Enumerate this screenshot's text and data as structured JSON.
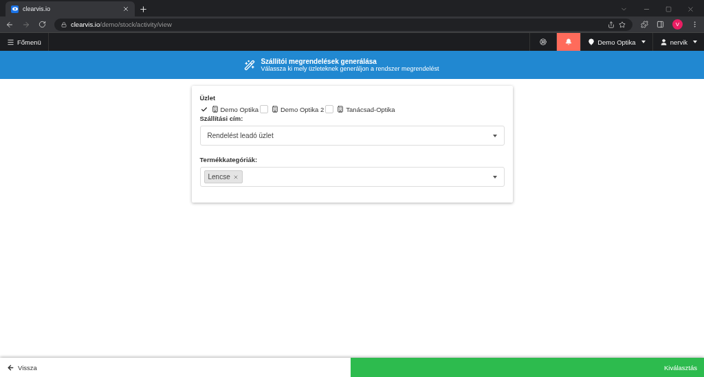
{
  "browser": {
    "tab_title": "clearvis.io",
    "url_host": "clearvis.io",
    "url_path": "/demo/stock/activity/view",
    "profile_initial": "V"
  },
  "navbar": {
    "menu_label": "Főmenü",
    "location": "Demo Optika",
    "user": "nervik",
    "alert_active": true
  },
  "banner": {
    "title": "Szállítói megrendelések generálása",
    "subtitle": "Válassza ki mely üzleteknek generáljon a rendszer megrendelést"
  },
  "form": {
    "store_label": "Üzlet",
    "stores": [
      {
        "label": "Demo Optika",
        "checked": true
      },
      {
        "label": "Demo Optika 2",
        "checked": false
      },
      {
        "label": "Tanácsad-Optika",
        "checked": false
      }
    ],
    "shipping_label": "Szállítási cím:",
    "shipping_value": "Rendelést leadó üzlet",
    "category_label": "Termékkategóriák:",
    "categories": [
      "Lencse"
    ]
  },
  "footer": {
    "back": "Vissza",
    "confirm": "Kiválasztás"
  }
}
